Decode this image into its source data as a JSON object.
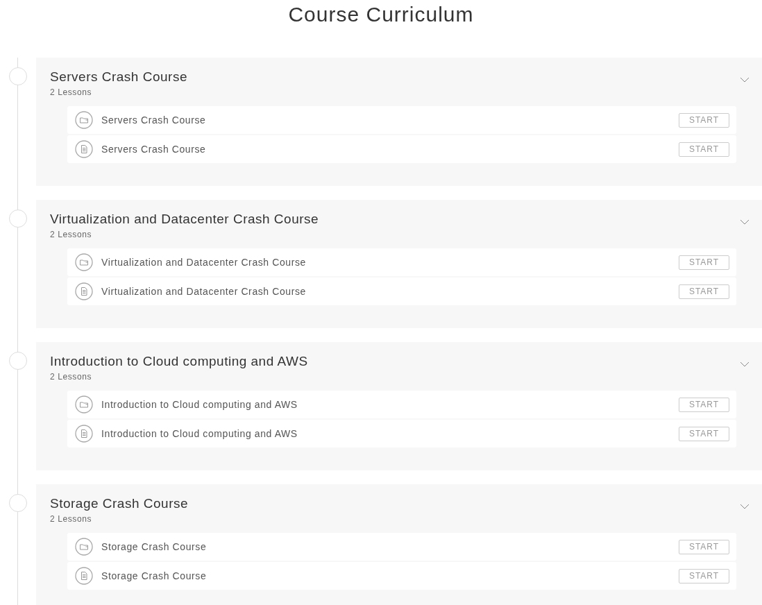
{
  "title": "Course Curriculum",
  "sections": [
    {
      "title": "Servers Crash Course",
      "count": "2 Lessons",
      "expanded": true,
      "lessons": [
        {
          "kind": "video",
          "title": "Servers Crash Course",
          "action": "START"
        },
        {
          "kind": "document",
          "title": "Servers Crash Course",
          "action": "START"
        }
      ]
    },
    {
      "title": "Virtualization and Datacenter Crash Course",
      "count": "2 Lessons",
      "expanded": true,
      "lessons": [
        {
          "kind": "video",
          "title": "Virtualization and Datacenter Crash Course",
          "action": "START"
        },
        {
          "kind": "document",
          "title": "Virtualization and Datacenter Crash Course",
          "action": "START"
        }
      ]
    },
    {
      "title": "Introduction to Cloud computing and AWS",
      "count": "2 Lessons",
      "expanded": true,
      "lessons": [
        {
          "kind": "video",
          "title": "Introduction to Cloud computing and AWS",
          "action": "START"
        },
        {
          "kind": "document",
          "title": "Introduction to Cloud computing and AWS",
          "action": "START"
        }
      ]
    },
    {
      "title": "Storage Crash Course",
      "count": "2 Lessons",
      "expanded": true,
      "lessons": [
        {
          "kind": "video",
          "title": "Storage Crash Course",
          "action": "START"
        },
        {
          "kind": "document",
          "title": "Storage Crash Course",
          "action": "START"
        }
      ]
    }
  ]
}
